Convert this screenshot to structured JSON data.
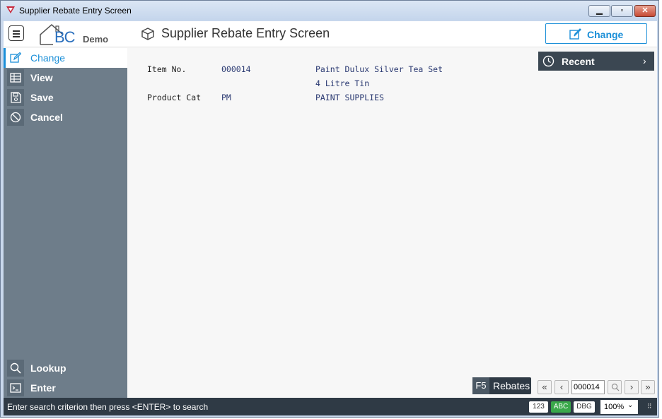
{
  "window": {
    "title": "Supplier Rebate Entry Screen"
  },
  "header": {
    "logo_text": "BC",
    "logo_subtitle": "Demo",
    "screen_title": "Supplier Rebate Entry Screen",
    "change_button": "Change"
  },
  "sidebar": {
    "items": [
      {
        "label": "Change",
        "icon": "edit-icon",
        "active": true
      },
      {
        "label": "View",
        "icon": "table-icon"
      },
      {
        "label": "Save",
        "icon": "save-icon"
      },
      {
        "label": "Cancel",
        "icon": "cancel-icon"
      }
    ],
    "bottom_items": [
      {
        "label": "Lookup",
        "icon": "search-icon"
      },
      {
        "label": "Enter",
        "icon": "terminal-icon"
      }
    ]
  },
  "form": {
    "item_no_label": "Item No.",
    "item_no_value": "000014",
    "item_desc_line1": "Paint Dulux Silver Tea Set",
    "item_desc_line2": "4 Litre Tin",
    "product_cat_label": "Product Cat",
    "product_cat_value": "PM",
    "product_cat_desc": "PAINT SUPPLIES"
  },
  "recent": {
    "label": "Recent"
  },
  "function_keys": {
    "key": "F5",
    "label": "Rebates"
  },
  "navigation": {
    "record_value": "000014"
  },
  "status": {
    "message": "Enter search criterion then press <ENTER> to search",
    "badge_123": "123",
    "badge_abc": "ABC",
    "badge_dbg": "DBG",
    "zoom": "100%"
  },
  "colors": {
    "accent": "#1b8fd8",
    "sidebar": "#6e7d8a",
    "statusbar": "#2f3a45",
    "abc_badge": "#3aa84a"
  }
}
